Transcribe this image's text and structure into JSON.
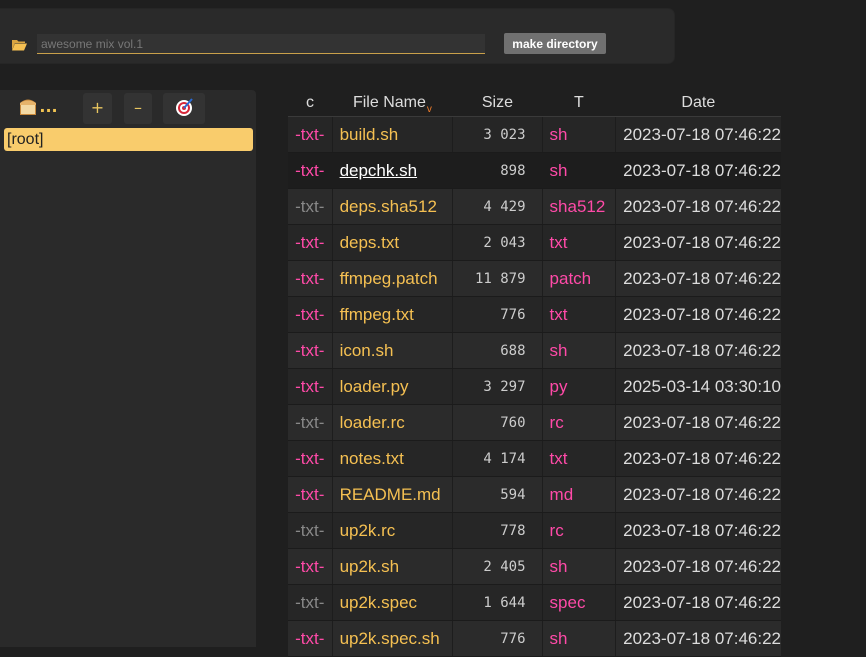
{
  "mkdir": {
    "placeholder": "awesome mix vol.1",
    "button_label": "make directory"
  },
  "tree": {
    "bread_dots": "...",
    "plus_label": "+",
    "minus_label": "–",
    "root_label": "[root]"
  },
  "table": {
    "headers": {
      "c": "c",
      "name": "File Name",
      "sort_indicator": "v",
      "size": "Size",
      "type": "T",
      "date": "Date"
    },
    "rows": [
      {
        "c": "-txt-",
        "name": "build.sh",
        "size": "3 023",
        "type": "sh",
        "date": "2023-07-18 07:46:22"
      },
      {
        "c": "-txt-",
        "name": "depchk.sh",
        "size": "898",
        "type": "sh",
        "date": "2023-07-18 07:46:22"
      },
      {
        "c": "-txt-",
        "name": "deps.sha512",
        "size": "4 429",
        "type": "sha512",
        "date": "2023-07-18 07:46:22"
      },
      {
        "c": "-txt-",
        "name": "deps.txt",
        "size": "2 043",
        "type": "txt",
        "date": "2023-07-18 07:46:22"
      },
      {
        "c": "-txt-",
        "name": "ffmpeg.patch",
        "size": "11 879",
        "type": "patch",
        "date": "2023-07-18 07:46:22"
      },
      {
        "c": "-txt-",
        "name": "ffmpeg.txt",
        "size": "776",
        "type": "txt",
        "date": "2023-07-18 07:46:22"
      },
      {
        "c": "-txt-",
        "name": "icon.sh",
        "size": "688",
        "type": "sh",
        "date": "2023-07-18 07:46:22"
      },
      {
        "c": "-txt-",
        "name": "loader.py",
        "size": "3 297",
        "type": "py",
        "date": "2025-03-14 03:30:10"
      },
      {
        "c": "-txt-",
        "name": "loader.rc",
        "size": "760",
        "type": "rc",
        "date": "2023-07-18 07:46:22"
      },
      {
        "c": "-txt-",
        "name": "notes.txt",
        "size": "4 174",
        "type": "txt",
        "date": "2023-07-18 07:46:22"
      },
      {
        "c": "-txt-",
        "name": "README.md",
        "size": "594",
        "type": "md",
        "date": "2023-07-18 07:46:22"
      },
      {
        "c": "-txt-",
        "name": "up2k.rc",
        "size": "778",
        "type": "rc",
        "date": "2023-07-18 07:46:22"
      },
      {
        "c": "-txt-",
        "name": "up2k.sh",
        "size": "2 405",
        "type": "sh",
        "date": "2023-07-18 07:46:22"
      },
      {
        "c": "-txt-",
        "name": "up2k.spec",
        "size": "1 644",
        "type": "spec",
        "date": "2023-07-18 07:46:22"
      },
      {
        "c": "-txt-",
        "name": "up2k.spec.sh",
        "size": "776",
        "type": "sh",
        "date": "2023-07-18 07:46:22"
      }
    ]
  }
}
